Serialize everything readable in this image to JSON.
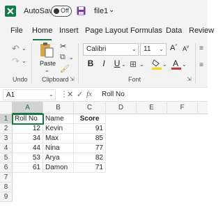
{
  "titlebar": {
    "autosave": "AutoSave",
    "toggle_state": "Off",
    "filename": "file1"
  },
  "tabs": [
    "File",
    "Home",
    "Insert",
    "Page Layout",
    "Formulas",
    "Data",
    "Review"
  ],
  "ribbon": {
    "undo_label": "Undo",
    "paste_label": "Paste",
    "clipboard_label": "Clipboard",
    "font_name": "Calibri",
    "font_size": "11",
    "font_label": "Font",
    "bold": "B",
    "italic": "I",
    "underline": "U"
  },
  "formula_bar": {
    "name_box": "A1",
    "content": "Roll No"
  },
  "columns": [
    "A",
    "B",
    "C",
    "D",
    "E",
    "F"
  ],
  "rows": [
    "1",
    "2",
    "3",
    "4",
    "5",
    "6",
    "7",
    "8",
    "9"
  ],
  "table": {
    "headers": [
      "Roll No",
      "Name",
      "Score"
    ],
    "data": [
      [
        "12",
        "Kevin",
        "91"
      ],
      [
        "34",
        "Max",
        "85"
      ],
      [
        "44",
        "Nina",
        "77"
      ],
      [
        "53",
        "Arya",
        "82"
      ],
      [
        "61",
        "Damon",
        "71"
      ]
    ]
  },
  "colors": {
    "accent": "#107c41"
  }
}
